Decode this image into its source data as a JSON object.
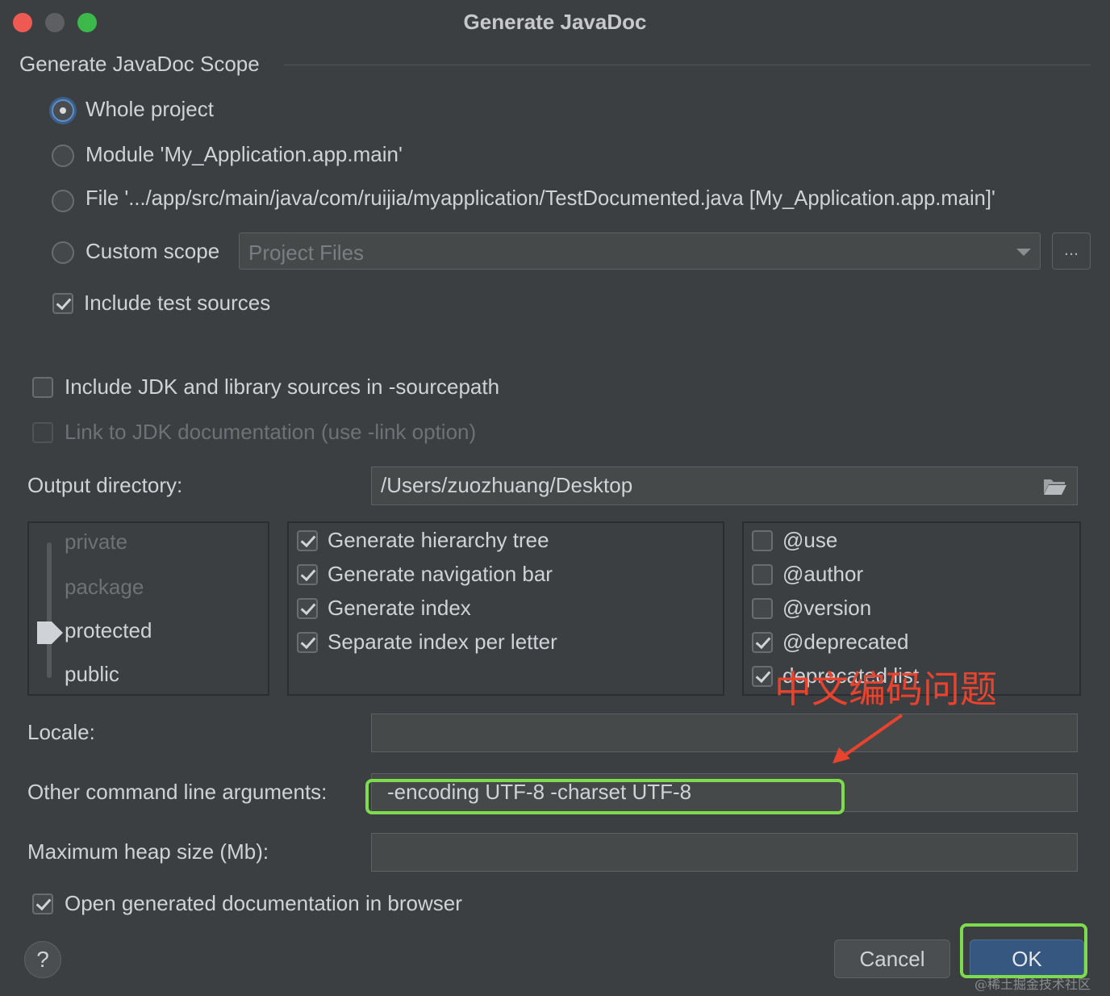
{
  "window": {
    "title": "Generate JavaDoc"
  },
  "scope": {
    "group_title": "Generate JavaDoc Scope",
    "options": [
      {
        "label": "Whole project",
        "selected": true
      },
      {
        "label": "Module 'My_Application.app.main'",
        "selected": false
      },
      {
        "label": "File '.../app/src/main/java/com/ruijia/myapplication/TestDocumented.java [My_Application.app.main]'",
        "selected": false
      },
      {
        "label": "Custom scope",
        "selected": false
      }
    ],
    "custom_scope_value": "Project Files",
    "browse_label": "...",
    "include_test_sources": {
      "label": "Include test sources",
      "checked": true
    }
  },
  "sources": {
    "include_jdk": {
      "label": "Include JDK and library sources in -sourcepath",
      "checked": false
    },
    "link_jdk": {
      "label": "Link to JDK documentation (use -link option)",
      "checked": false,
      "disabled": true
    }
  },
  "output": {
    "label": "Output directory:",
    "value": "/Users/zuozhuang/Desktop"
  },
  "visibility": {
    "levels": [
      "private",
      "package",
      "protected",
      "public"
    ],
    "selected": "protected"
  },
  "generate_options": [
    {
      "label": "Generate hierarchy tree",
      "checked": true
    },
    {
      "label": "Generate navigation bar",
      "checked": true
    },
    {
      "label": "Generate index",
      "checked": true
    },
    {
      "label": "Separate index per letter",
      "checked": true
    }
  ],
  "tag_options": [
    {
      "label": "@use",
      "checked": false
    },
    {
      "label": "@author",
      "checked": false
    },
    {
      "label": "@version",
      "checked": false
    },
    {
      "label": "@deprecated",
      "checked": true
    },
    {
      "label": "deprecated list",
      "checked": true
    }
  ],
  "locale": {
    "label": "Locale:",
    "value": ""
  },
  "args": {
    "label": "Other command line arguments:",
    "value": "-encoding UTF-8 -charset UTF-8"
  },
  "heap": {
    "label": "Maximum heap size (Mb):",
    "value": ""
  },
  "open_browser": {
    "label": "Open generated documentation in browser",
    "checked": true
  },
  "buttons": {
    "help": "?",
    "cancel": "Cancel",
    "ok": "OK"
  },
  "annotation": {
    "text": "中文编码问题",
    "color": "#e8432f",
    "highlight_color": "#7ddc4d"
  },
  "watermark": "@稀土掘金技术社区"
}
